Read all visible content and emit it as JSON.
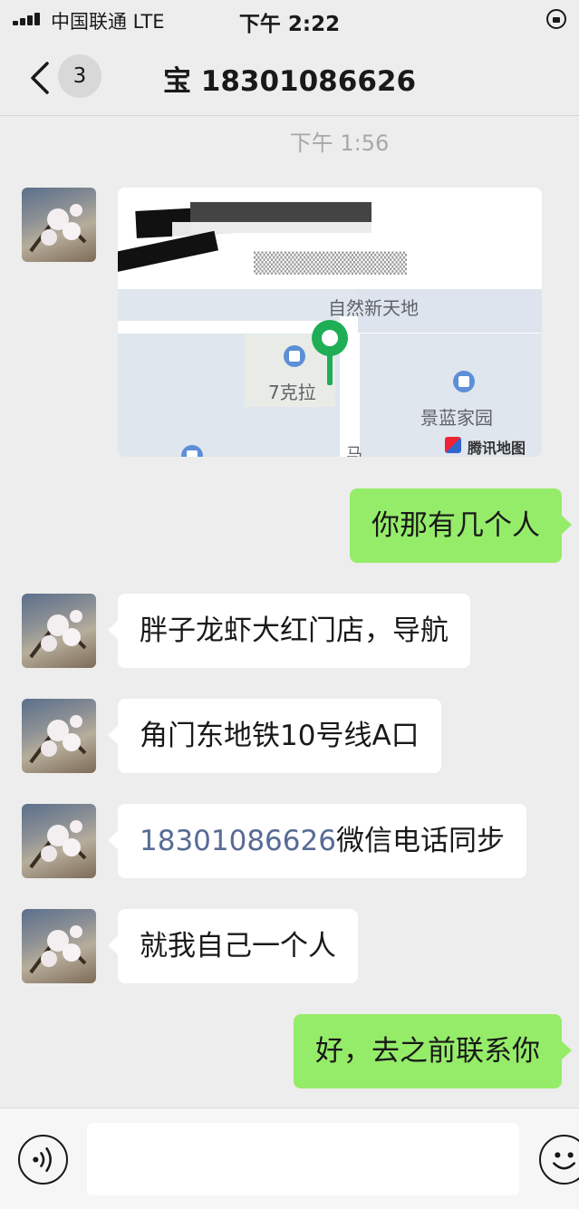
{
  "status_bar": {
    "carrier": "中国联通  LTE",
    "time": "下午 2:22"
  },
  "nav": {
    "unread_count": "3",
    "title": "宝 18301086626"
  },
  "timestamp": "下午 1:56",
  "location": {
    "map_labels": {
      "top": "自然新天地",
      "left": "7克拉",
      "right": "景蓝家园",
      "road": "马"
    },
    "map_logo": "腾讯地图"
  },
  "messages": [
    {
      "side": "right",
      "text": "你那有几个人"
    },
    {
      "side": "left",
      "text": "胖子龙虾大红门店，导航"
    },
    {
      "side": "left",
      "text": "角门东地铁10号线A口"
    },
    {
      "side": "left",
      "phone": "18301086626",
      "text": "微信电话同步"
    },
    {
      "side": "left",
      "text": "就我自己一个人"
    },
    {
      "side": "right",
      "text": "好，去之前联系你"
    }
  ],
  "input": {
    "placeholder": ""
  },
  "colors": {
    "background": "#ededed",
    "bubble_self": "#95ec69",
    "bubble_other": "#ffffff",
    "link": "#576b95"
  },
  "icons": [
    "back-icon",
    "voice-icon",
    "emoji-icon",
    "pin-icon",
    "lock-icon"
  ]
}
